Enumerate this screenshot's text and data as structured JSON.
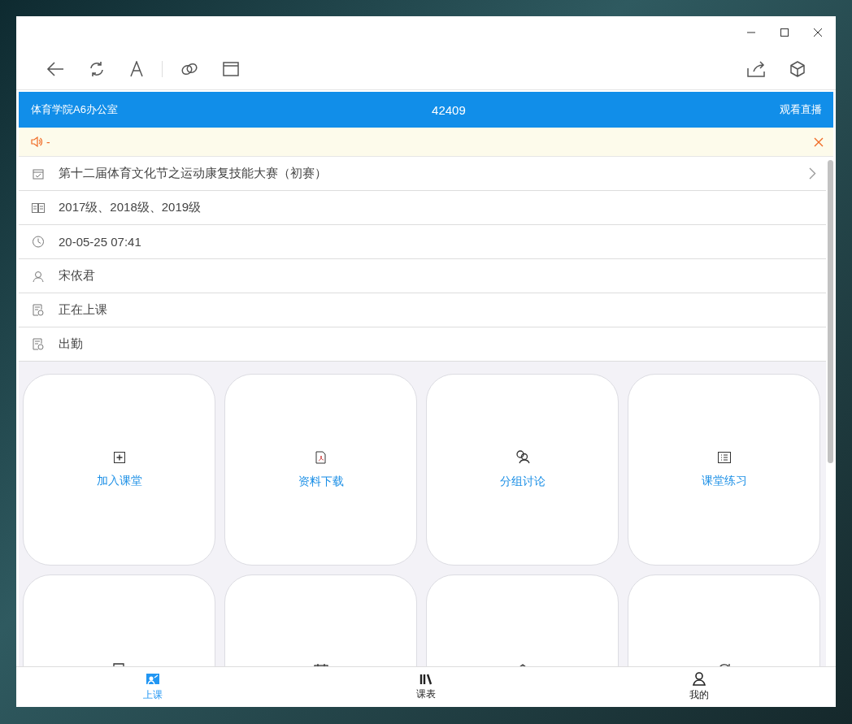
{
  "header": {
    "room": "体育学院A6办公室",
    "code": "42409",
    "live_link": "观看直播"
  },
  "notice": {
    "text": "-"
  },
  "details": [
    {
      "kind": "link",
      "text": "第十二届体育文化节之运动康复技能大赛（初赛）"
    },
    {
      "kind": "info",
      "text": "2017级、2018级、2019级"
    },
    {
      "kind": "info",
      "text": "20-05-25 07:41"
    },
    {
      "kind": "info",
      "text": "宋依君"
    },
    {
      "kind": "info",
      "text": "正在上课"
    },
    {
      "kind": "info",
      "text": "出勤"
    }
  ],
  "tiles": [
    {
      "kind": "labeled",
      "label": "加入课堂"
    },
    {
      "kind": "labeled",
      "label": "资料下载"
    },
    {
      "kind": "labeled",
      "label": "分组讨论"
    },
    {
      "kind": "labeled",
      "label": "课堂练习"
    },
    {
      "kind": "icon-only"
    },
    {
      "kind": "icon-only"
    },
    {
      "kind": "icon-only"
    },
    {
      "kind": "icon-only"
    }
  ],
  "tabs": [
    {
      "label": "上课",
      "selected": true
    },
    {
      "label": "课表",
      "selected": false
    },
    {
      "label": "我的",
      "selected": false
    }
  ]
}
